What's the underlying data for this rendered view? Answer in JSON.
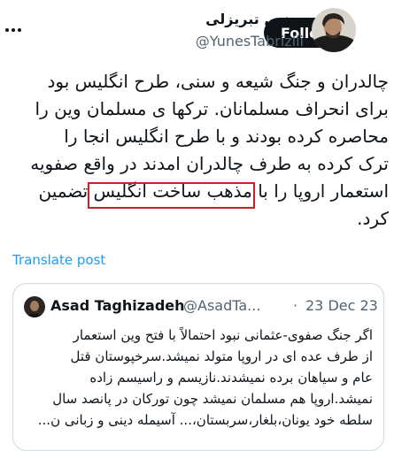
{
  "header": {
    "display_name": "یونس تبریزلی",
    "handle": "@YunesTabrizlii",
    "follow_label": "Follow"
  },
  "tweet": {
    "lines": [
      "چالدران و جنگ شیعه و سنی، طرح انگلیس بود",
      "برای انحراف مسلمانان. ترکها ی مسلمان وین را",
      "محاصره کرده بودند و با طرح انگلیس انجا را",
      "ترک کرده به طرف چالدران امدند در واقع صفویه",
      "استعمار اروپا را با مذهب ساخت انگلیس تضمین",
      "کرد."
    ],
    "highlight": "مذهب ساخت انگلیس"
  },
  "translate_label": "Translate post",
  "quote": {
    "name": "Asad Taghizadeh",
    "handle": "@AsadTa...",
    "separator": "·",
    "date": "23 Dec 23",
    "lines": [
      "اگر جنگ صفوی-عثمانی نبود احتمالاً با فتح وین استعمار",
      "از طرف عده ای در اروپا متولد نمیشد.سرخپوستان قتل",
      "عام و سیاهان برده نمیشدند.نازیسم و راسیسم زاده",
      "نمیشد.اروپا هم مسلمان نمیشد چون تورکان در پانصد سال",
      "سلطه خود یونان،بلغار،سربستان،... آسیمله دینی و زبانی ن..."
    ]
  },
  "colors": {
    "follow_bg": "#0f1419",
    "link": "#1d9bf0",
    "highlight_border": "#d01c24",
    "muted": "#536471"
  },
  "icons": {
    "more": "more-horizontal-icon"
  }
}
